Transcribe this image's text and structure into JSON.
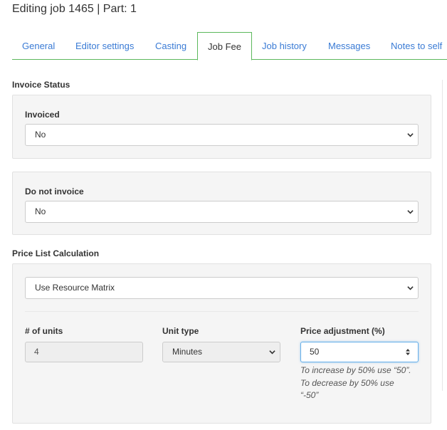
{
  "page": {
    "title": "Editing job 1465 | Part: 1"
  },
  "tabs": [
    {
      "label": "General"
    },
    {
      "label": "Editor settings"
    },
    {
      "label": "Casting"
    },
    {
      "label": "Job Fee"
    },
    {
      "label": "Job history"
    },
    {
      "label": "Messages"
    },
    {
      "label": "Notes to self"
    }
  ],
  "active_tab": "Job Fee",
  "invoice_status": {
    "title": "Invoice Status",
    "invoiced": {
      "label": "Invoiced",
      "value": "No"
    },
    "do_not_invoice": {
      "label": "Do not invoice",
      "value": "No"
    }
  },
  "price_list": {
    "title": "Price List Calculation",
    "method": {
      "value": "Use Resource Matrix"
    },
    "units": {
      "label": "# of units",
      "value": "4"
    },
    "unit_type": {
      "label": "Unit type",
      "value": "Minutes"
    },
    "price_adjustment": {
      "label": "Price adjustment (%)",
      "value": "50",
      "help_1": "To increase by 50% use “50”.",
      "help_2": "To decrease by 50% use",
      "help_3": "“-50”"
    }
  },
  "colors": {
    "link": "#3a7bd5",
    "tab_border": "#5cb85c",
    "panel_bg": "#f5f5f5",
    "focus": "#66afe9"
  },
  "icons": {
    "select_arrow": "chevron-down-icon",
    "number_spinner": "spinner-icon"
  }
}
